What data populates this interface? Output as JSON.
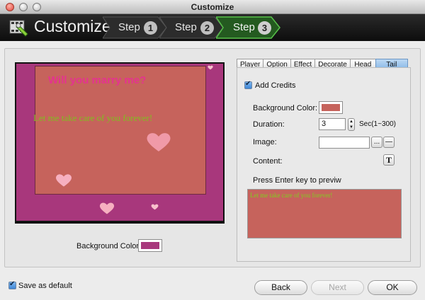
{
  "window": {
    "title": "Customize"
  },
  "header": {
    "logo_text": "Customize",
    "steps": [
      {
        "label": "Step",
        "number": "1"
      },
      {
        "label": "Step",
        "number": "2"
      },
      {
        "label": "Step",
        "number": "3"
      }
    ],
    "active_step": 3
  },
  "preview": {
    "title_text": "Will you marry me?",
    "credit_text": "Let me take care of you forever!",
    "background_color_label": "Background Color:",
    "background_color": "#a8377c",
    "card_color": "#c6635c"
  },
  "tabs": [
    "Player",
    "Option",
    "Effect",
    "Decorate",
    "Head",
    "Tail"
  ],
  "active_tab": "Tail",
  "tail": {
    "add_credits_label": "Add Credits",
    "add_credits_checked": true,
    "background_color_label": "Background Color:",
    "background_color": "#c6635c",
    "duration_label": "Duration:",
    "duration_value": "3",
    "duration_range": "Sec(1~300)",
    "image_label": "Image:",
    "browse_label": "...",
    "remove_label": "—",
    "content_label": "Content:",
    "text_button_label": "T",
    "hint": "Press Enter key to previw",
    "content_text": "Let me take care of you forever!"
  },
  "footer": {
    "save_default_label": "Save as default",
    "save_default_checked": true,
    "back_label": "Back",
    "next_label": "Next",
    "ok_label": "OK"
  },
  "colors": {
    "accent_green": "#3d9a3a",
    "text_green": "#7fbf1f",
    "pink_title": "#e4338f"
  }
}
